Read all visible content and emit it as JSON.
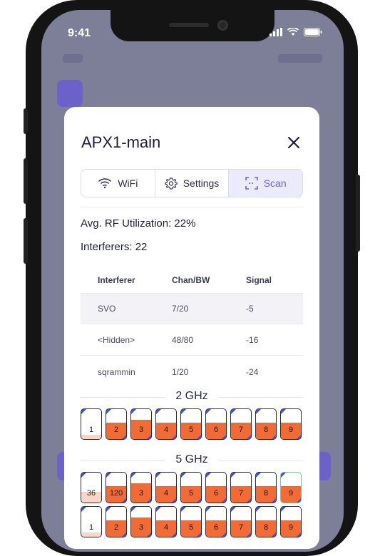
{
  "status_bar": {
    "time": "9:41"
  },
  "modal": {
    "title": "APX1-main",
    "tabs": [
      {
        "label": "WiFi",
        "icon": "wifi-icon",
        "active": false
      },
      {
        "label": "Settings",
        "icon": "gear-icon",
        "active": false
      },
      {
        "label": "Scan",
        "icon": "scan-icon",
        "active": true
      }
    ],
    "avg_rf": "Avg. RF Utilization: 22%",
    "interferers": "Interferers: 22"
  },
  "table": {
    "headers": [
      "Interferer",
      "Chan/BW",
      "Signal"
    ],
    "rows": [
      [
        "SVO",
        "7/20",
        "-5"
      ],
      [
        "<Hidden>",
        "48/80",
        "-16"
      ],
      [
        "sqrammin",
        "1/20",
        "-24"
      ]
    ]
  },
  "bands": [
    {
      "label": "2 GHz"
    },
    {
      "label": "5 GHz"
    }
  ],
  "channels_2ghz": [
    {
      "num": "1",
      "fill": 0.15
    },
    {
      "num": "2",
      "fill": 0.55
    },
    {
      "num": "3",
      "fill": 0.65
    },
    {
      "num": "4",
      "fill": 0.55
    },
    {
      "num": "5",
      "fill": 0.55
    },
    {
      "num": "6",
      "fill": 0.55
    },
    {
      "num": "7",
      "fill": 0.55
    },
    {
      "num": "8",
      "fill": 0.55
    },
    {
      "num": "9",
      "fill": 0.55
    }
  ],
  "channels_5ghz_row1": [
    {
      "num": "36",
      "fill": 0.35
    },
    {
      "num": "120",
      "fill": 0.55
    },
    {
      "num": "3",
      "fill": 0.65
    },
    {
      "num": "4",
      "fill": 0.55
    },
    {
      "num": "5",
      "fill": 0.55
    },
    {
      "num": "6",
      "fill": 0.55
    },
    {
      "num": "7",
      "fill": 0.55
    },
    {
      "num": "8",
      "fill": 0.55
    },
    {
      "num": "9",
      "fill": 0.55
    }
  ],
  "channels_5ghz_row2": [
    {
      "num": "1",
      "fill": 0.15
    },
    {
      "num": "2",
      "fill": 0.55
    },
    {
      "num": "3",
      "fill": 0.65
    },
    {
      "num": "4",
      "fill": 0.55
    },
    {
      "num": "5",
      "fill": 0.55
    },
    {
      "num": "6",
      "fill": 0.55
    },
    {
      "num": "7",
      "fill": 0.55
    },
    {
      "num": "8",
      "fill": 0.55
    },
    {
      "num": "9",
      "fill": 0.55
    }
  ],
  "colors": {
    "accent": "#6a5cf0",
    "utilization": "#f26b35",
    "marker": "#3d4fd8"
  }
}
